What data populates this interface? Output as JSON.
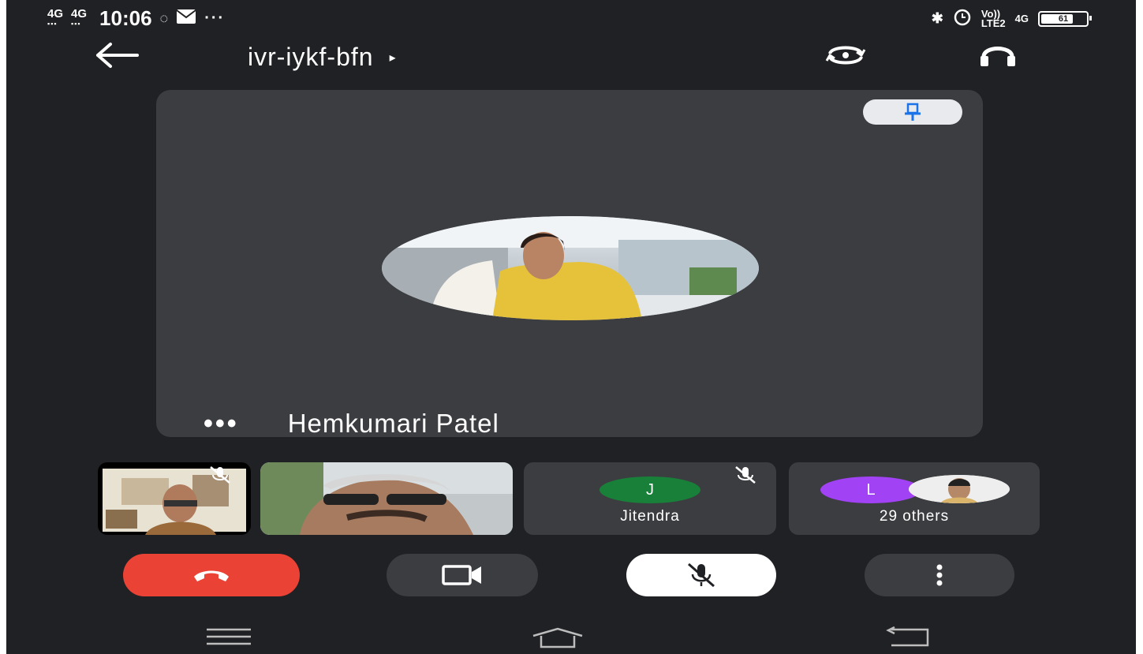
{
  "status_bar": {
    "signal1": "4G",
    "signal2": "4G",
    "time": "10:06",
    "more": "···",
    "volte": "Vo))",
    "lte": "LTE2",
    "net": "4G",
    "battery": "61"
  },
  "header": {
    "meeting_code": "ivr-iykf-bfn",
    "caret": "▸"
  },
  "main_tile": {
    "speaker_name": "Hemkumari Patel",
    "more": "•••"
  },
  "thumbnails": [
    {
      "kind": "video"
    },
    {
      "kind": "video"
    },
    {
      "kind": "initial",
      "initial": "J",
      "name": "Jitendra",
      "color": "#188038"
    },
    {
      "kind": "initial",
      "initial": "L",
      "name": "29 others",
      "color": "#a142f4"
    }
  ],
  "controls": {
    "end_color": "#ea4335"
  },
  "colors": {
    "background": "#202124",
    "tile": "#3c3d41",
    "pin": "#1a73e8"
  }
}
